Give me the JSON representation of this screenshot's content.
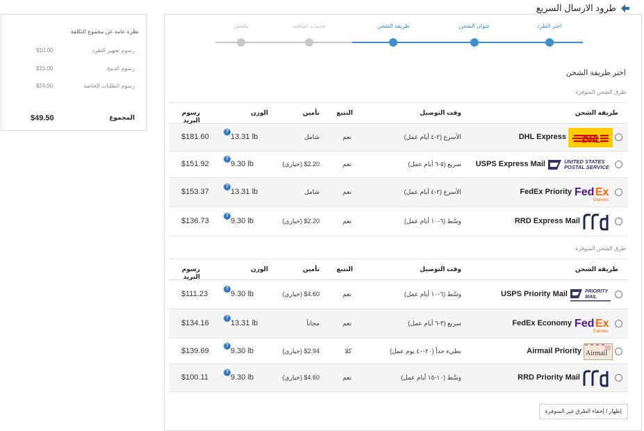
{
  "header": {
    "title": "طرود الارسال السريع",
    "back_icon": "arrow-left-icon"
  },
  "summary": {
    "title": "نظرة عامة عن مجموع التكلفة",
    "rows": [
      {
        "label": "رسوم تجهيز الطرد",
        "value": "$10.00"
      },
      {
        "label": "رسوم الدمج",
        "value": "$15.00"
      },
      {
        "label": "رسوم الطلبات الخاصة",
        "value": "$24.50"
      }
    ],
    "total_label": "المجموع",
    "total_value": "$49.50"
  },
  "stepper": {
    "steps": [
      {
        "label": "اختر الطرد",
        "done": true
      },
      {
        "label": "عنوان الشحن",
        "done": true
      },
      {
        "label": "طريقة الشحن",
        "done": true
      },
      {
        "label": "خدمات اضافية",
        "done": false
      },
      {
        "label": "ملخص",
        "done": false
      }
    ],
    "accent": "#3a8fd0",
    "inactive": "#c8c8c8"
  },
  "section_title": "اختر طريقة الشحن",
  "columns": {
    "method": "طريقة الشحن",
    "delivery": "وقت التوصيل",
    "tracking": "التتبع",
    "insurance": "تأمين",
    "weight": "الوزن",
    "postage": "رسوم البريد"
  },
  "groups": [
    {
      "subtitle": "طرق الشحن المتوفرة",
      "rows": [
        {
          "logo": "dhl",
          "name": "DHL Express",
          "delivery": "الأسرع (٢-٤ أيام عمل)",
          "tracking": "نعم",
          "insurance": "شامل",
          "weight": "13.31 lb",
          "postage": "$181.60"
        },
        {
          "logo": "usps-express",
          "name": "USPS Express Mail",
          "delivery": "سريع (٥-٦ أيام عمل)",
          "tracking": "نعم",
          "insurance": "$2.20 (خياري)",
          "weight": "9.30 lb",
          "postage": "$151.92"
        },
        {
          "logo": "fedex",
          "name": "FedEx Priority",
          "delivery": "الأسرع (٢-٤ أيام عمل)",
          "tracking": "نعم",
          "insurance": "شامل",
          "weight": "13.31 lb",
          "postage": "$153.37"
        },
        {
          "logo": "rrd",
          "name": "RRD Express Mail",
          "delivery": "وسَّط (٦-١٠ أيام عمل)",
          "tracking": "نعم",
          "insurance": "$2.20 (خياري)",
          "weight": "9.30 lb",
          "postage": "$136.73"
        }
      ]
    },
    {
      "subtitle": "طرق الشحن المتوفرة",
      "rows": [
        {
          "logo": "usps-priority",
          "name": "USPS Priority Mail",
          "delivery": "وسَّط (٦-١٠ أيام عمل)",
          "tracking": "نعم",
          "insurance": "$4.60 (خياري)",
          "weight": "9.30 lb",
          "postage": "$111.23"
        },
        {
          "logo": "fedex",
          "name": "FedEx Economy",
          "delivery": "سريع (٣-٦ أيام عمل)",
          "tracking": "نعم",
          "insurance": "مجاناً",
          "weight": "13.31 lb",
          "postage": "$134.16"
        },
        {
          "logo": "airmail",
          "name": "Airmail Priority",
          "delivery": "بطيء جداً (٢٠-٤٠ يوم عمل)",
          "tracking": "كلا",
          "insurance": "$2.94 (خياري)",
          "weight": "9.30 lb",
          "postage": "$139.69"
        },
        {
          "logo": "rrd",
          "name": "RRD Priority Mail",
          "delivery": "وسَّط (١٠-١٥ أيام عمل)",
          "tracking": "نعم",
          "insurance": "$4.60 (خياري)",
          "weight": "9.30 lb",
          "postage": "$100.11"
        }
      ]
    }
  ],
  "toggle_button": "إظهار / إخفاء الطرق غير المتوفرة"
}
